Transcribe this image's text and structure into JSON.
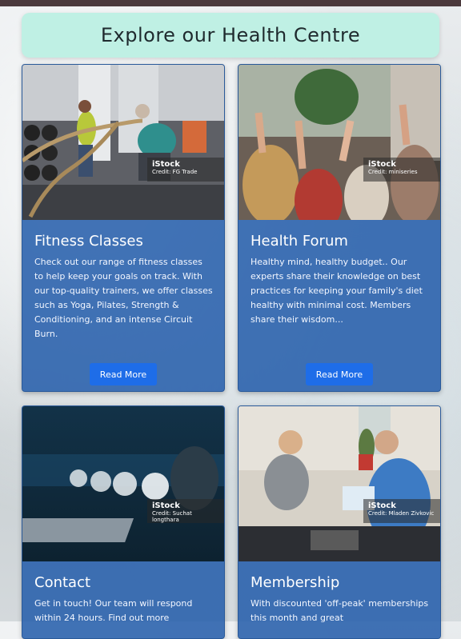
{
  "header": {
    "title": "Explore our Health Centre"
  },
  "cards": [
    {
      "title": "Fitness Classes",
      "body": "Check out our range of fitness classes to help keep your goals on track. With our top-quality trainers, we offer classes such as Yoga, Pilates, Strength & Conditioning, and an intense Circuit Burn.",
      "button": "Read More",
      "credit_brand": "iStock",
      "credit_text": "Credit: FG Trade"
    },
    {
      "title": "Health Forum",
      "body": "Healthy mind, healthy budget.. Our experts share their knowledge on best practices for keeping your family's diet healthy with minimal cost. Members share their wisdom...",
      "button": "Read More",
      "credit_brand": "iStock",
      "credit_text": "Credit: miniseries"
    },
    {
      "title": "Contact",
      "body": "Get in touch! Our team will respond within 24 hours. Find out more",
      "credit_brand": "iStock",
      "credit_text": "Credit: Suchat longthara"
    },
    {
      "title": "Membership",
      "body": "With discounted 'off-peak' memberships this month and great",
      "credit_brand": "iStock",
      "credit_text": "Credit: Mladen Zivkovic"
    }
  ],
  "colors": {
    "card_bg": "#235caa",
    "header_bg": "#bff0e4",
    "button_bg": "#1e6de8"
  }
}
